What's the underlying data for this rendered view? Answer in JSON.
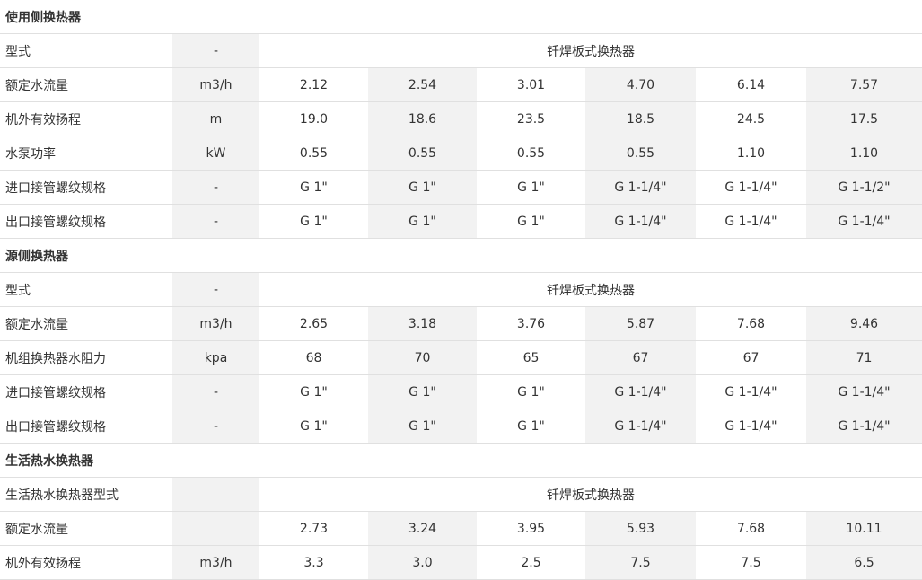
{
  "sections": [
    {
      "title": "使用侧换热器",
      "rows": [
        {
          "label": "型式",
          "unit": "-",
          "span": "钎焊板式换热器"
        },
        {
          "label": "额定水流量",
          "unit": "m3/h",
          "values": [
            "2.12",
            "2.54",
            "3.01",
            "4.70",
            "6.14",
            "7.57"
          ]
        },
        {
          "label": "机外有效扬程",
          "unit": "m",
          "values": [
            "19.0",
            "18.6",
            "23.5",
            "18.5",
            "24.5",
            "17.5"
          ]
        },
        {
          "label": "水泵功率",
          "unit": "kW",
          "values": [
            "0.55",
            "0.55",
            "0.55",
            "0.55",
            "1.10",
            "1.10"
          ]
        },
        {
          "label": "进口接管螺纹规格",
          "unit": "-",
          "values": [
            "G 1\"",
            "G 1\"",
            "G 1\"",
            "G 1-1/4\"",
            "G 1-1/4\"",
            "G 1-1/2\""
          ]
        },
        {
          "label": "出口接管螺纹规格",
          "unit": "-",
          "values": [
            "G 1\"",
            "G 1\"",
            "G 1\"",
            "G 1-1/4\"",
            "G 1-1/4\"",
            "G 1-1/4\""
          ]
        }
      ]
    },
    {
      "title": "源侧换热器",
      "rows": [
        {
          "label": "型式",
          "unit": "-",
          "span": "钎焊板式换热器"
        },
        {
          "label": "额定水流量",
          "unit": "m3/h",
          "values": [
            "2.65",
            "3.18",
            "3.76",
            "5.87",
            "7.68",
            "9.46"
          ]
        },
        {
          "label": "机组换热器水阻力",
          "unit": "kpa",
          "values": [
            "68",
            "70",
            "65",
            "67",
            "67",
            "71"
          ]
        },
        {
          "label": "进口接管螺纹规格",
          "unit": "-",
          "values": [
            "G 1\"",
            "G 1\"",
            "G 1\"",
            "G 1-1/4\"",
            "G 1-1/4\"",
            "G 1-1/4\""
          ]
        },
        {
          "label": "出口接管螺纹规格",
          "unit": "-",
          "values": [
            "G 1\"",
            "G 1\"",
            "G 1\"",
            "G 1-1/4\"",
            "G 1-1/4\"",
            "G 1-1/4\""
          ]
        }
      ]
    },
    {
      "title": "生活热水换热器",
      "rows": [
        {
          "label": "生活热水换热器型式",
          "unit": "",
          "span": "钎焊板式换热器"
        },
        {
          "label": "额定水流量",
          "unit": "",
          "values": [
            "2.73",
            "3.24",
            "3.95",
            "5.93",
            "7.68",
            "10.11"
          ]
        },
        {
          "label": "机外有效扬程",
          "unit": "m3/h",
          "values": [
            "3.3",
            "3.0",
            "2.5",
            "7.5",
            "7.5",
            "6.5"
          ]
        }
      ]
    }
  ]
}
